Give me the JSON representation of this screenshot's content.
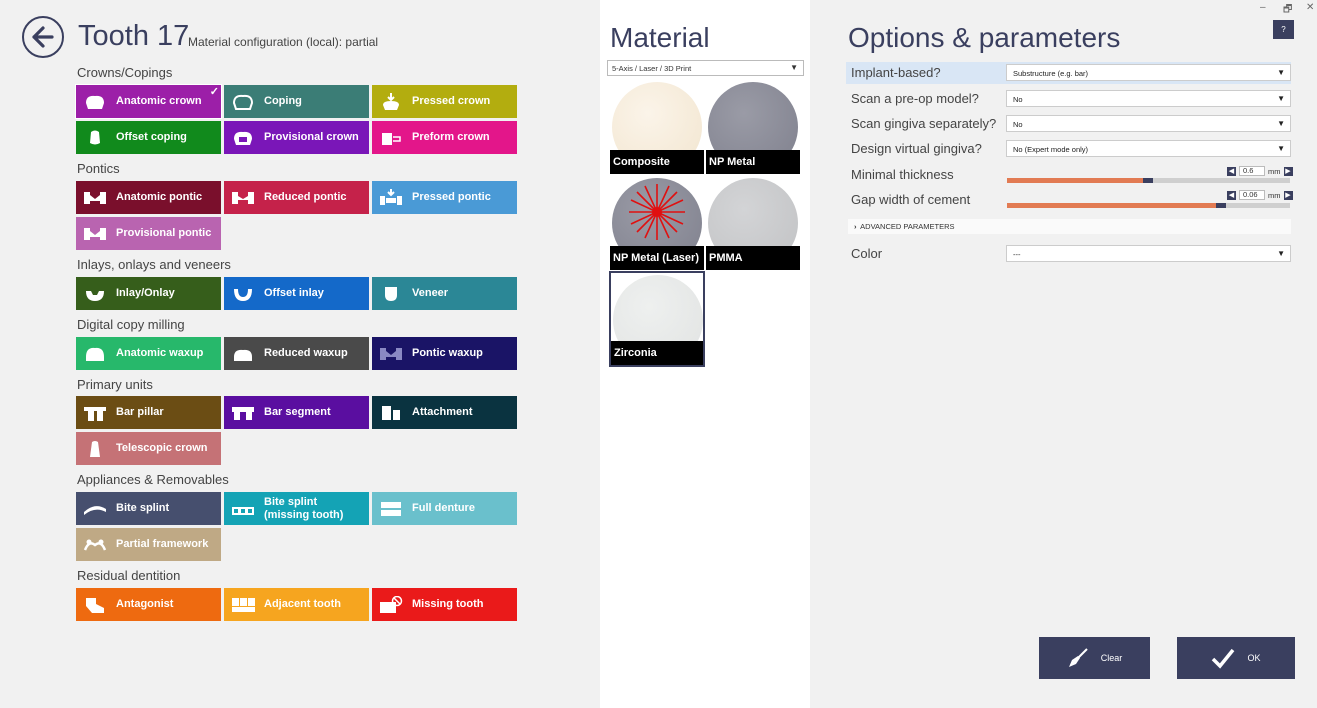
{
  "header": {
    "title": "Tooth 17",
    "subtitle": "Material configuration (local):  partial"
  },
  "sections": [
    {
      "label": "Crowns/Copings"
    },
    {
      "label": "Pontics"
    },
    {
      "label": "Inlays, onlays and veneers"
    },
    {
      "label": "Digital copy milling"
    },
    {
      "label": "Primary units"
    },
    {
      "label": "Appliances & Removables"
    },
    {
      "label": "Residual dentition"
    }
  ],
  "tiles": {
    "anatomic_crown": {
      "label": "Anatomic crown",
      "color": "#9c1fa8",
      "selected": true
    },
    "coping": {
      "label": "Coping",
      "color": "#3b7d76"
    },
    "pressed_crown": {
      "label": "Pressed crown",
      "color": "#b3ad0f"
    },
    "offset_coping": {
      "label": "Offset coping",
      "color": "#118a1c"
    },
    "provisional_crown": {
      "label": "Provisional crown",
      "color": "#7a16b8"
    },
    "preform_crown": {
      "label": "Preform crown",
      "color": "#e3168a"
    },
    "anatomic_pontic": {
      "label": "Anatomic pontic",
      "color": "#7a0f2c"
    },
    "reduced_pontic": {
      "label": "Reduced pontic",
      "color": "#c5224a"
    },
    "pressed_pontic": {
      "label": "Pressed pontic",
      "color": "#4a9ad6"
    },
    "provisional_pontic": {
      "label": "Provisional pontic",
      "color": "#b964b0"
    },
    "inlay_onlay": {
      "label": "Inlay/Onlay",
      "color": "#365e1b"
    },
    "offset_inlay": {
      "label": "Offset inlay",
      "color": "#1469c9"
    },
    "veneer": {
      "label": "Veneer",
      "color": "#2b8796"
    },
    "anatomic_waxup": {
      "label": "Anatomic waxup",
      "color": "#27b86b"
    },
    "reduced_waxup": {
      "label": "Reduced waxup",
      "color": "#4a4a4a"
    },
    "pontic_waxup": {
      "label": "Pontic waxup",
      "color": "#1a1466"
    },
    "bar_pillar": {
      "label": "Bar pillar",
      "color": "#6b4d14"
    },
    "bar_segment": {
      "label": "Bar segment",
      "color": "#5a0ea0"
    },
    "attachment": {
      "label": "Attachment",
      "color": "#0a3340"
    },
    "telescopic_crown": {
      "label": "Telescopic crown",
      "color": "#c57276"
    },
    "bite_splint": {
      "label": "Bite splint",
      "color": "#464f6e"
    },
    "bite_splint_missing": {
      "label": "Bite splint (missing tooth)",
      "color": "#14a3b5"
    },
    "full_denture": {
      "label": "Full denture",
      "color": "#6ac0cc"
    },
    "partial_framework": {
      "label": "Partial framework",
      "color": "#bfa985"
    },
    "antagonist": {
      "label": "Antagonist",
      "color": "#ee6a10"
    },
    "adjacent_tooth": {
      "label": "Adjacent tooth",
      "color": "#f6a51f"
    },
    "missing_tooth": {
      "label": "Missing tooth",
      "color": "#ea1a1a"
    }
  },
  "material": {
    "title": "Material",
    "machine_select": "5-Axis / Laser / 3D Print",
    "items": [
      {
        "name": "Composite",
        "color": "#f5ebdc"
      },
      {
        "name": "NP Metal",
        "color": "#8a8b98"
      },
      {
        "name": "NP Metal (Laser)",
        "color": "#8a8b98"
      },
      {
        "name": "PMMA",
        "color": "#c8c9cb"
      },
      {
        "name": "Zirconia",
        "color": "#e7e9e8",
        "selected": true
      }
    ]
  },
  "options": {
    "title": "Options & parameters",
    "help": "?",
    "implant_based": {
      "label": "Implant-based?",
      "value": "Substructure (e.g. bar)"
    },
    "scan_preop": {
      "label": "Scan a pre-op model?",
      "value": "No"
    },
    "scan_gingiva": {
      "label": "Scan gingiva separately?",
      "value": "No"
    },
    "design_gingiva": {
      "label": "Design virtual gingiva?",
      "value": "No (Expert mode only)"
    },
    "min_thickness": {
      "label": "Minimal thickness",
      "value": "0.6",
      "unit": "mm",
      "level": 0.48
    },
    "gap_cement": {
      "label": "Gap width of cement",
      "value": "0.06",
      "unit": "mm",
      "level": 0.74
    },
    "advanced": "ADVANCED PARAMETERS",
    "color": {
      "label": "Color",
      "value": "---"
    }
  },
  "window": {
    "minimize": "–",
    "restore": "🗗",
    "close": "✕"
  },
  "actions": {
    "clear": "Clear",
    "ok": "OK"
  },
  "accent": "#3a3f5f"
}
